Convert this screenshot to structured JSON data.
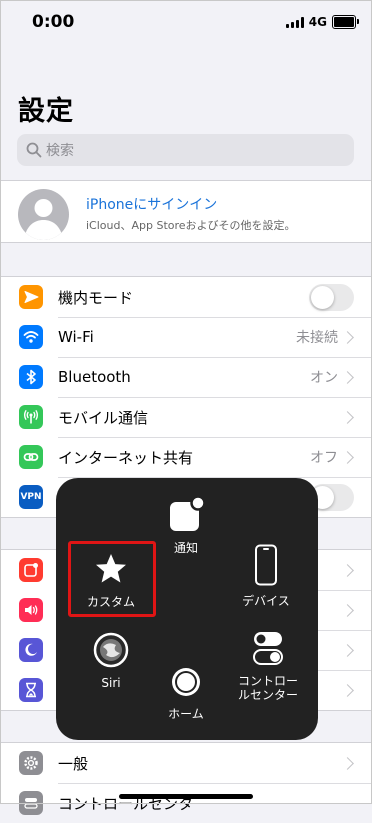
{
  "status_bar": {
    "time": "0:00",
    "network": "4G"
  },
  "page": {
    "title": "設定"
  },
  "search": {
    "placeholder": "検索"
  },
  "profile": {
    "title": "iPhoneにサインイン",
    "subtitle": "iCloud、App Storeおよびその他を設定。"
  },
  "network_rows": [
    {
      "label": "機内モード",
      "icon": "airplane-icon",
      "color": "#ff9500",
      "control": "toggle",
      "toggle_on": false
    },
    {
      "label": "Wi-Fi",
      "value": "未接続",
      "icon": "wifi-icon",
      "color": "#007aff"
    },
    {
      "label": "Bluetooth",
      "value": "オン",
      "icon": "bluetooth-icon",
      "color": "#007aff"
    },
    {
      "label": "モバイル通信",
      "value": "",
      "icon": "antenna-icon",
      "color": "#34c759"
    },
    {
      "label": "インターネット共有",
      "value": "オフ",
      "icon": "link-icon",
      "color": "#34c759"
    },
    {
      "icon": "vpn-icon",
      "icon_text": "VPN",
      "color": "#0a5dc2",
      "control": "toggle",
      "toggle_on": false
    }
  ],
  "notification_icons": [
    {
      "icon": "notifications-icon",
      "color": "#ff3b30"
    },
    {
      "icon": "sounds-icon",
      "color": "#ff2d55"
    },
    {
      "icon": "focus-moon-icon",
      "color": "#5856d6"
    },
    {
      "icon": "screen-time-icon",
      "color": "#5856d6"
    }
  ],
  "general": {
    "label": "一般",
    "icon": "gear-icon",
    "color": "#8e8e93"
  },
  "control_center": {
    "label": "コントロールセンタ",
    "icon": "control-center-icon",
    "color": "#8e8e93"
  },
  "assistive_touch": {
    "notifications": "通知",
    "custom": "カスタム",
    "device": "デバイス",
    "siri": "Siri",
    "home": "ホーム",
    "control_center": "コントロールセンター",
    "highlight_color": "#e01515"
  }
}
